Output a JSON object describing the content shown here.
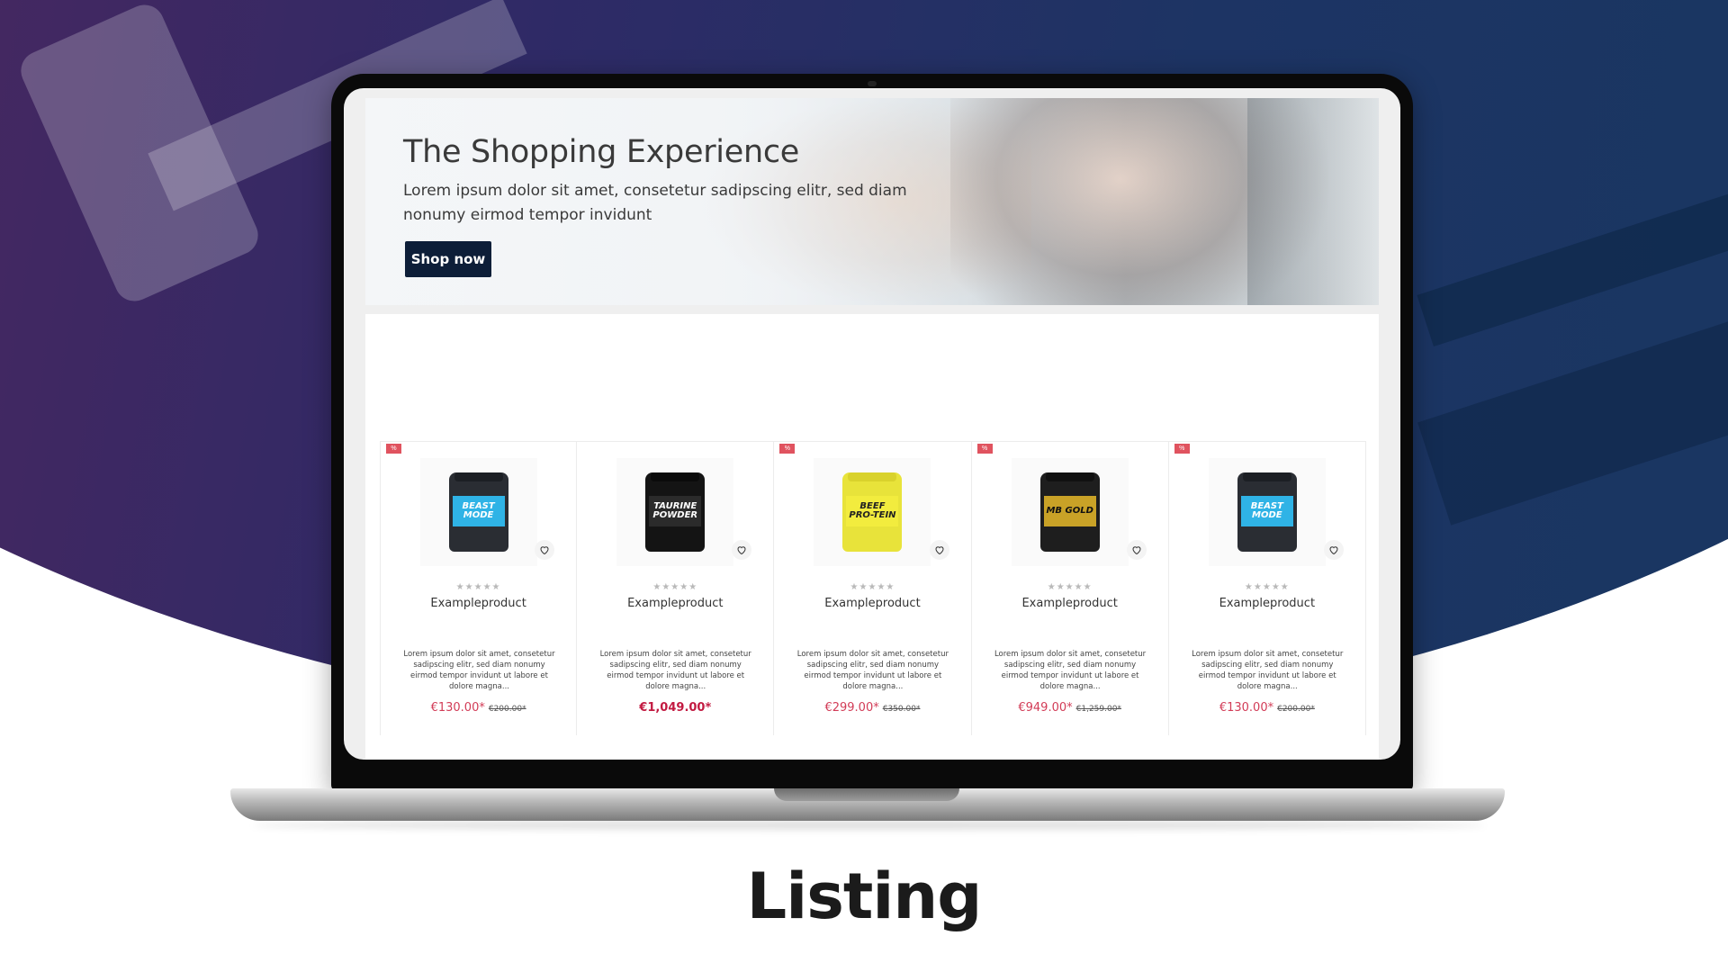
{
  "hero": {
    "title": "The Shopping Experience",
    "text": "Lorem ipsum dolor sit amet, consetetur sadipscing elitr, sed diam nonumy eirmod tempor invidunt",
    "button_label": "Shop now"
  },
  "products": [
    {
      "badge": "%",
      "image_label": "BEAST MODE",
      "image_colors": {
        "body": "#2a2d33",
        "label": "#2fb3e6",
        "lid": "#1c1f24"
      },
      "rating_stars": "★★★★★",
      "name": "Exampleproduct",
      "description": "Lorem ipsum dolor sit amet, consetetur sadipscing elitr, sed diam nonumy eirmod tempor invidunt ut labore et dolore magna...",
      "price": "€130.00*",
      "old_price": "€200.00*"
    },
    {
      "badge": "",
      "image_label": "TAURINE POWDER",
      "image_colors": {
        "body": "#141414",
        "label": "#2b2b2b",
        "lid": "#0b0b0b"
      },
      "rating_stars": "★★★★★",
      "name": "Exampleproduct",
      "description": "Lorem ipsum dolor sit amet, consetetur sadipscing elitr, sed diam nonumy eirmod tempor invidunt ut labore et dolore magna...",
      "price": "€1,049.00*",
      "old_price": ""
    },
    {
      "badge": "%",
      "image_label": "BEEF PRO-TEIN",
      "image_colors": {
        "body": "#e8e33a",
        "label": "#f2ec3e",
        "lid": "#d9d22c"
      },
      "rating_stars": "★★★★★",
      "name": "Exampleproduct",
      "description": "Lorem ipsum dolor sit amet, consetetur sadipscing elitr, sed diam nonumy eirmod tempor invidunt ut labore et dolore magna...",
      "price": "€299.00*",
      "old_price": "€350.00*"
    },
    {
      "badge": "%",
      "image_label": "MB GOLD",
      "image_colors": {
        "body": "#1e1e1e",
        "label": "#c9a227",
        "lid": "#111111"
      },
      "rating_stars": "★★★★★",
      "name": "Exampleproduct",
      "description": "Lorem ipsum dolor sit amet, consetetur sadipscing elitr, sed diam nonumy eirmod tempor invidunt ut labore et dolore magna...",
      "price": "€949.00*",
      "old_price": "€1,259.00*"
    },
    {
      "badge": "%",
      "image_label": "BEAST MODE",
      "image_colors": {
        "body": "#2a2d33",
        "label": "#2fb3e6",
        "lid": "#1c1f24"
      },
      "rating_stars": "★★★★★",
      "name": "Exampleproduct",
      "description": "Lorem ipsum dolor sit amet, consetetur sadipscing elitr, sed diam nonumy eirmod tempor invidunt ut labore et dolore magna...",
      "price": "€130.00*",
      "old_price": "€200.00*"
    }
  ],
  "icons": {
    "wishlist": "heart-icon"
  },
  "caption": "Listing",
  "colors": {
    "button_bg": "#0d1e38",
    "price": "#d23c57",
    "badge": "#e0535f"
  }
}
